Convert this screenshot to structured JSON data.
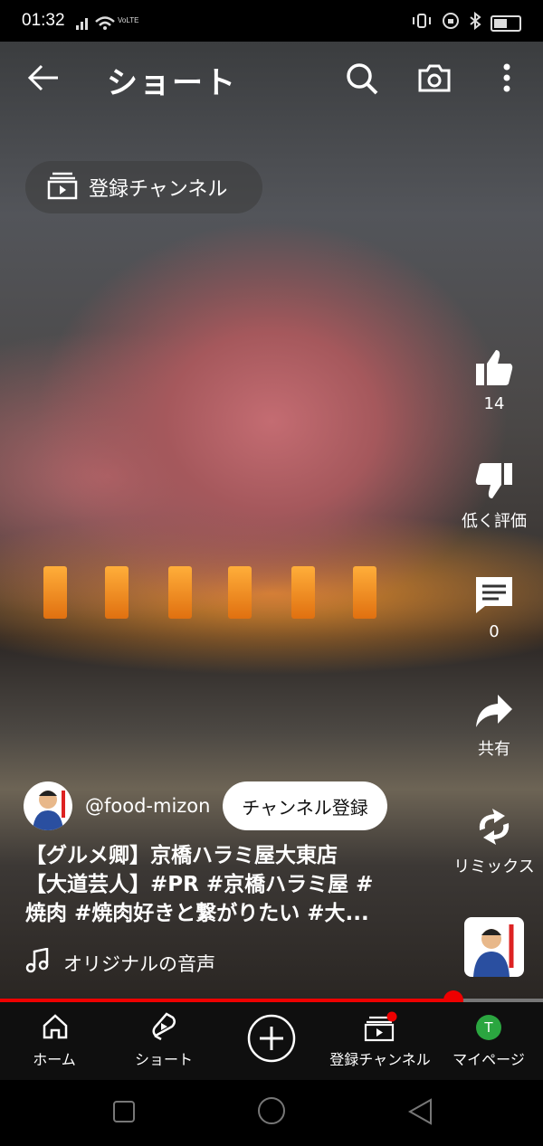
{
  "status": {
    "time": "01:32",
    "network": "VoLTE"
  },
  "topbar": {
    "title": "ショート"
  },
  "subscriptions_pill": {
    "label": "登録チャンネル"
  },
  "rail": {
    "like": {
      "label": "14"
    },
    "dislike": {
      "label": "低く評価"
    },
    "comments": {
      "label": "0"
    },
    "share": {
      "label": "共有"
    },
    "remix": {
      "label": "リミックス"
    }
  },
  "channel": {
    "handle": "@food-mizon",
    "subscribe_label": "チャンネル登録"
  },
  "description": {
    "lines": [
      "【グルメ卿】京橋ハラミ屋大東店",
      "【大道芸人】#PR #京橋ハラミ屋 #",
      "焼肉 #焼肉好きと繋がりたい #大..."
    ]
  },
  "music": {
    "label": "オリジナルの音声"
  },
  "progress": {
    "fraction": 0.835
  },
  "nav": {
    "home": "ホーム",
    "shorts": "ショート",
    "subscriptions": "登録チャンネル",
    "mypage": "マイページ",
    "avatar_letter": "T"
  },
  "colors": {
    "accent": "#e00000",
    "avatar_green": "#2ba640"
  }
}
